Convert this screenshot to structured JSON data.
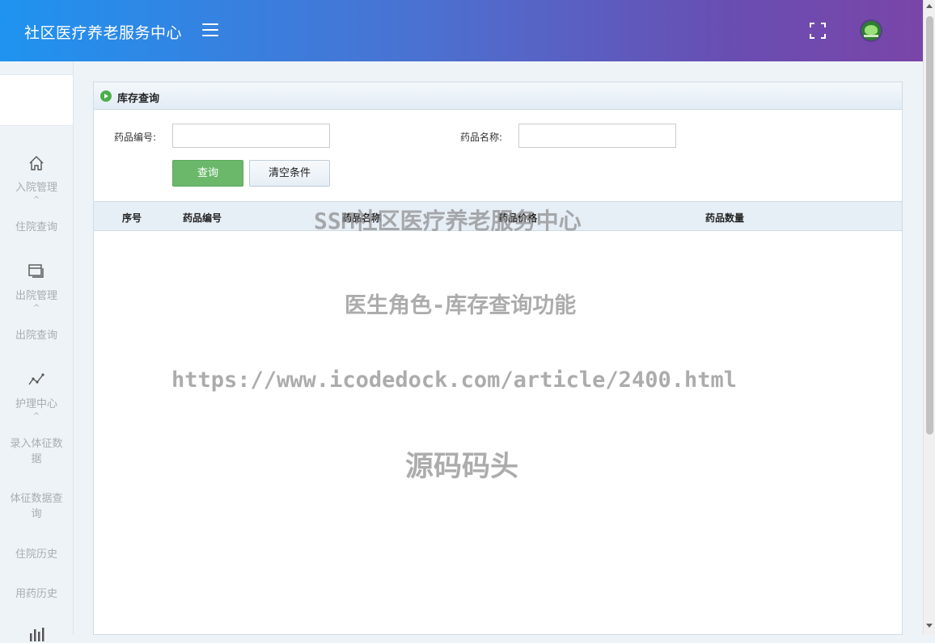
{
  "header": {
    "title": "社区医疗养老服务中心",
    "icons": [
      "menu-icon",
      "fullscreen-icon",
      "avatar"
    ]
  },
  "sidebar": {
    "items": [
      {
        "label": "入院管理",
        "icon": "home-icon",
        "group": true
      },
      {
        "label": "住院查询",
        "group": false
      },
      {
        "label": "出院管理",
        "icon": "window-icon",
        "group": true
      },
      {
        "label": "出院查询",
        "group": false
      },
      {
        "label": "护理中心",
        "icon": "line-chart-icon",
        "group": true
      },
      {
        "label": "录入体征数据",
        "group": false
      },
      {
        "label": "体征数据查询",
        "group": false
      },
      {
        "label": "住院历史",
        "group": false
      },
      {
        "label": "用药历史",
        "group": false
      }
    ],
    "caret": "^"
  },
  "panel": {
    "title": "库存查询",
    "form": {
      "drug_code_label": "药品编号:",
      "drug_code_value": "",
      "drug_name_label": "药品名称:",
      "drug_name_value": "",
      "query_button": "查询",
      "clear_button": "清空条件"
    },
    "table": {
      "columns": [
        "序号",
        "药品编号",
        "药品名称",
        "药品价格",
        "药品数量"
      ],
      "rows": []
    }
  },
  "watermarks": [
    "SSM社区医疗养老服务中心",
    "医生角色-库存查询功能",
    "https://www.icodedock.com/article/2400.html",
    "源码码头"
  ]
}
